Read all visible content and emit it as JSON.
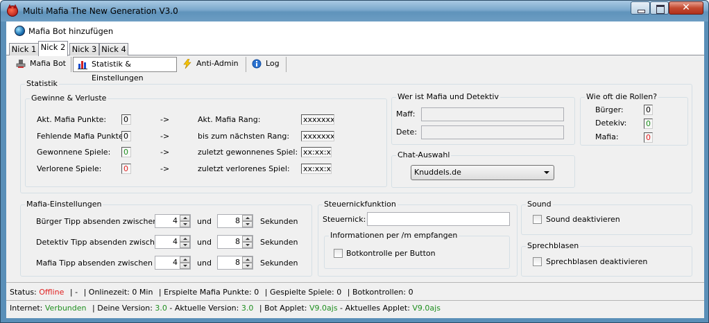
{
  "window": {
    "title": "Multi Mafia The New Generation V3.0",
    "close_glyph": "✕"
  },
  "menu": {
    "add_bot": "Mafia Bot hinzufügen"
  },
  "nick_tabs": [
    "Nick 1",
    "Nick 2",
    "Nick 3",
    "Nick 4"
  ],
  "sub_tabs": [
    "Mafia Bot",
    "Statistik & Einstellungen",
    "Anti-Admin",
    "Log"
  ],
  "statistik": {
    "label": "Statistik",
    "gewinne": {
      "label": "Gewinne & Verluste",
      "rows": [
        {
          "label": "Akt. Mafia Punkte:",
          "value": "0",
          "arrow": "->",
          "label2": "Akt. Mafia Rang:",
          "value2": "xxxxxxxx"
        },
        {
          "label": "Fehlende Mafia Punkte:",
          "value": "0",
          "arrow": "->",
          "label2": "bis zum nächsten Rang:",
          "value2": "xxxxxxxx"
        },
        {
          "label": "Gewonnene Spiele:",
          "value": "0",
          "arrow": "->",
          "label2": "zuletzt gewonnenes Spiel:",
          "value2": "xx:xx:xx"
        },
        {
          "label": "Verlorene Spiele:",
          "value": "0",
          "arrow": "->",
          "label2": "zuletzt verlorenes Spiel:",
          "value2": "xx:xx:xx"
        }
      ]
    },
    "wer_ist": {
      "label": "Wer ist Mafia und Detektiv",
      "maff_label": "Maff:",
      "dete_label": "Dete:",
      "maff_value": "",
      "dete_value": ""
    },
    "rollen": {
      "label": "Wie oft die Rollen?",
      "rows": [
        {
          "label": "Bürger:",
          "value": "0"
        },
        {
          "label": "Detekiv:",
          "value": "0"
        },
        {
          "label": "Mafia:",
          "value": "0"
        }
      ]
    },
    "chat": {
      "label": "Chat-Auswahl",
      "selected": "Knuddels.de"
    }
  },
  "einstellungen": {
    "label": "Mafia-Einstellungen",
    "rows": [
      {
        "label": "Bürger Tipp absenden zwischen",
        "min": "4",
        "und": "und",
        "max": "8",
        "unit": "Sekunden"
      },
      {
        "label": "Detektiv Tipp absenden zwischen",
        "min": "4",
        "und": "und",
        "max": "8",
        "unit": "Sekunden"
      },
      {
        "label": "Mafia Tipp absenden zwischen",
        "min": "4",
        "und": "und",
        "max": "8",
        "unit": "Sekunden"
      }
    ]
  },
  "steuernick": {
    "label": "Steuernickfunktion",
    "field_label": "Steuernick:",
    "field_value": "",
    "info_label": "Informationen per /m empfangen",
    "checkbox_label": "Botkontrolle per Button"
  },
  "sound": {
    "label": "Sound",
    "checkbox_label": "Sound deaktivieren"
  },
  "sprechblasen": {
    "label": "Sprechblasen",
    "checkbox_label": "Sprechblasen deaktivieren"
  },
  "status": {
    "status_label": "Status:",
    "status_value": "Offline",
    "dash": "-",
    "onlinezeit_label": "Onlinezeit:",
    "onlinezeit_value": "0",
    "onlinezeit_unit": "Min",
    "punkte_label": "Erspielte Mafia Punkte:",
    "punkte_value": "0",
    "spiele_label": "Gespielte Spiele:",
    "spiele_value": "0",
    "botkontrollen_label": "Botkontrollen:",
    "botkontrollen_value": "0",
    "sep": "|"
  },
  "internet": {
    "internet_label": "Internet:",
    "internet_value": "Verbunden",
    "deine_label": "Deine Version:",
    "deine_value": "3.0",
    "aktuelle_label": "- Aktuelle Version:",
    "aktuelle_value": "3.0",
    "bot_label": "Bot Applet:",
    "bot_value": "V9.0ajs",
    "akt_applet_label": "- Aktuelles Applet:",
    "akt_applet_value": "V9.0ajs",
    "sep": "|"
  },
  "colors": {
    "online_green": "#1f8f1f",
    "offline_red": "#e02020"
  }
}
